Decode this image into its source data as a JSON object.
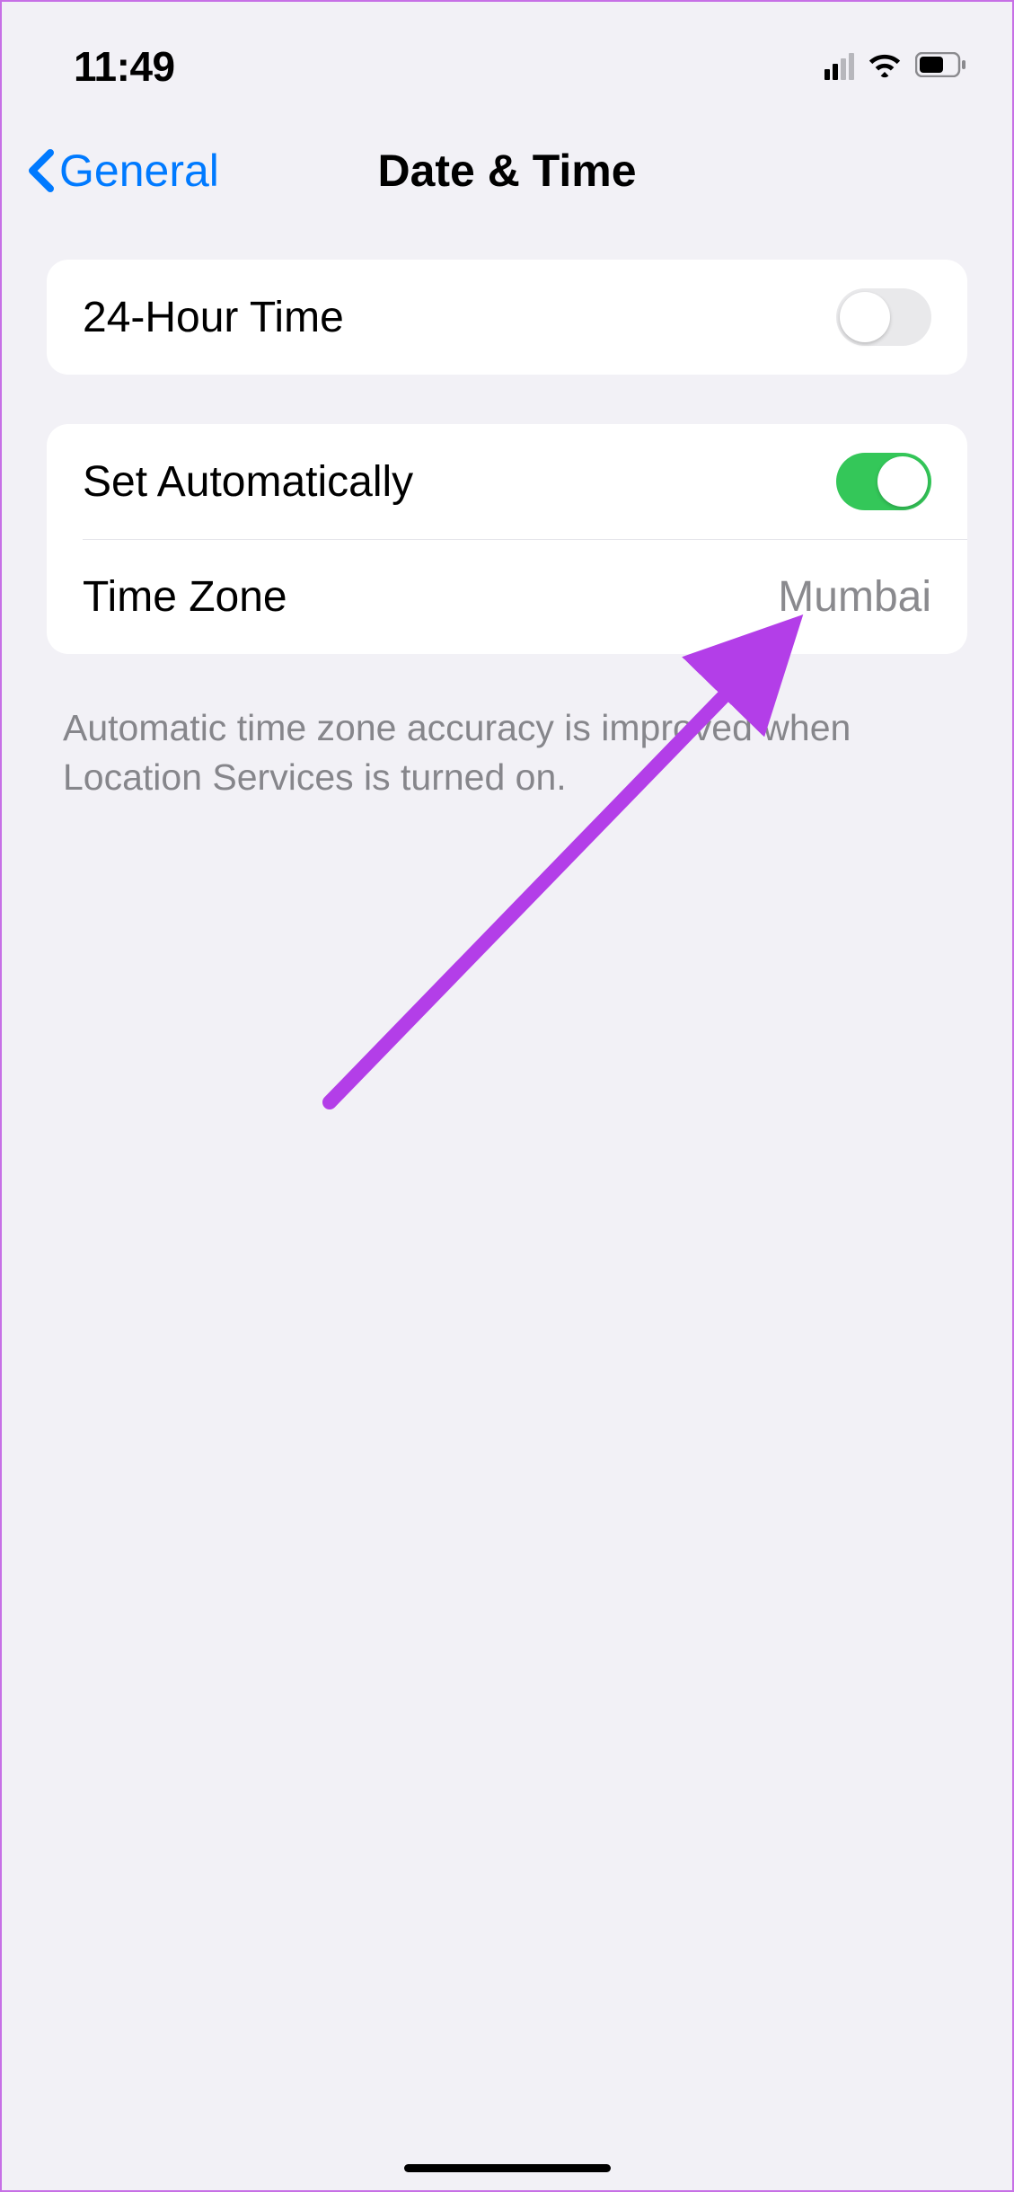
{
  "status": {
    "time": "11:49"
  },
  "nav": {
    "back_label": "General",
    "title": "Date & Time"
  },
  "rows": {
    "twenty_four_hour": {
      "label": "24-Hour Time",
      "on": false
    },
    "set_automatically": {
      "label": "Set Automatically",
      "on": true
    },
    "time_zone": {
      "label": "Time Zone",
      "value": "Mumbai"
    }
  },
  "footer": "Automatic time zone accuracy is improved when Location Services is turned on.",
  "colors": {
    "ios_blue": "#007aff",
    "toggle_green": "#34c759",
    "annotation_purple": "#b33ee8"
  }
}
